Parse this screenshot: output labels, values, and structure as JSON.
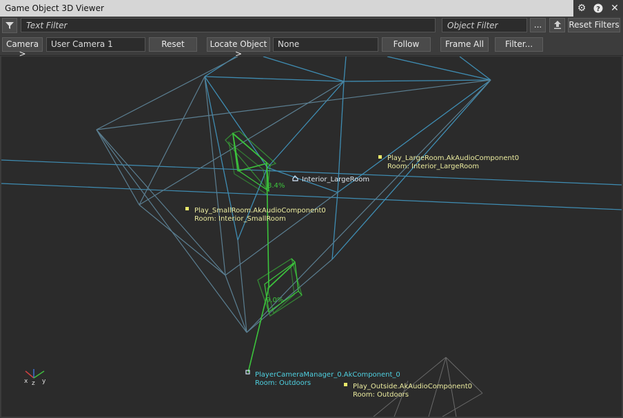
{
  "window": {
    "title": "Game Object 3D Viewer"
  },
  "toolbar_top": {
    "text_filter_placeholder": "Text Filter",
    "object_filter_placeholder": "Object Filter",
    "more_label": "...",
    "reset_filters_label": "Reset Filters"
  },
  "toolbar_camera": {
    "camera_label": "Camera >",
    "camera_value": "User Camera 1",
    "reset_label": "Reset",
    "locate_label": "Locate Object >",
    "locate_value": "None",
    "follow_label": "Follow",
    "frame_all_label": "Frame All",
    "filter_label": "Filter..."
  },
  "viewport": {
    "objects": [
      {
        "name": "Play_LargeRoom.AkAudioComponent0",
        "room": "Room: Interior_LargeRoom"
      },
      {
        "name": "Interior_LargeRoom"
      },
      {
        "name": "Play_SmallRoom.AkAudioComponent0",
        "room": "Room: Interior_SmallRoom"
      },
      {
        "name": "PlayerCameraManager_0.AkComponent_0",
        "room": "Room: Outdoors"
      },
      {
        "name": "Play_Outside.AkAudioComponent0",
        "room": "Room: Outdoors"
      }
    ],
    "percent_labels": [
      "8.4%",
      "9.0%"
    ],
    "axes": {
      "x": "x",
      "y": "y",
      "z": "z"
    }
  },
  "colors": {
    "wire_blue": "#3f8db3",
    "wire_green": "#3cc43c",
    "label_yellow": "#e8e86a",
    "label_cyan": "#4fd0e0"
  }
}
